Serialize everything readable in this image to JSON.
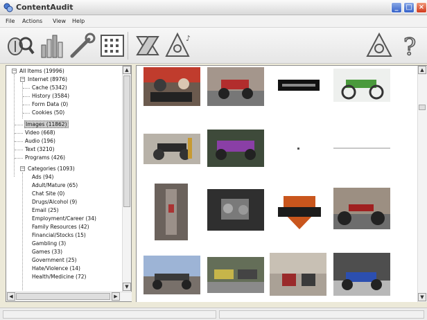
{
  "window": {
    "title": "ContentAudit"
  },
  "menu": [
    {
      "label": "File"
    },
    {
      "label": "Actions"
    },
    {
      "label": "View"
    },
    {
      "label": "Help"
    }
  ],
  "toolbar": {
    "icons": [
      "scan-icon",
      "stats-icon",
      "tools-icon",
      "grid-view-icon",
      "eraser-icon",
      "hazard-audio-icon",
      "hazard-icon",
      "help-icon"
    ]
  },
  "tree": {
    "root": "All Items (19996)",
    "internet": "Internet (8976)",
    "internet_children": [
      "Cache (5342)",
      "History (3584)",
      "Form Data (0)",
      "Cookies (50)"
    ],
    "top_items": [
      "Images (11862)",
      "Video (668)",
      "Audio (196)",
      "Text (3210)",
      "Programs (426)"
    ],
    "categories": "Categories (1093)",
    "category_children": [
      "Ads (94)",
      "Adult/Mature (65)",
      "Chat Site (0)",
      "Drugs/Alcohol (9)",
      "Email (25)",
      "Employment/Career (34)",
      "Family Resources (42)",
      "Financial/Stocks (15)",
      "Gambling (3)",
      "Games (33)",
      "Government (25)",
      "Hate/Violence (14)",
      "Health/Medicine (72)"
    ]
  },
  "images": {
    "thumbnails": [
      "motorcycle-people-thumbnail",
      "motorcycle-red-thumbnail",
      "banner-thumbnail",
      "motorcycle-green-thumbnail",
      "motorcycle-dark-thumbnail",
      "motorcycle-purple-thumbnail",
      "dot-thumbnail",
      "line-thumbnail",
      "exhaust-thumbnail",
      "engine-thumbnail",
      "harley-logo-thumbnail",
      "motorcycle-chopper-thumbnail",
      "motorcycle-parking-thumbnail",
      "motorcycle-group-thumbnail",
      "motorcycle-street-thumbnail",
      "motorcycle-blue-thumbnail"
    ]
  },
  "colors": {
    "selection": "#cfcfcf",
    "title_bar": "#e9e9e9"
  }
}
